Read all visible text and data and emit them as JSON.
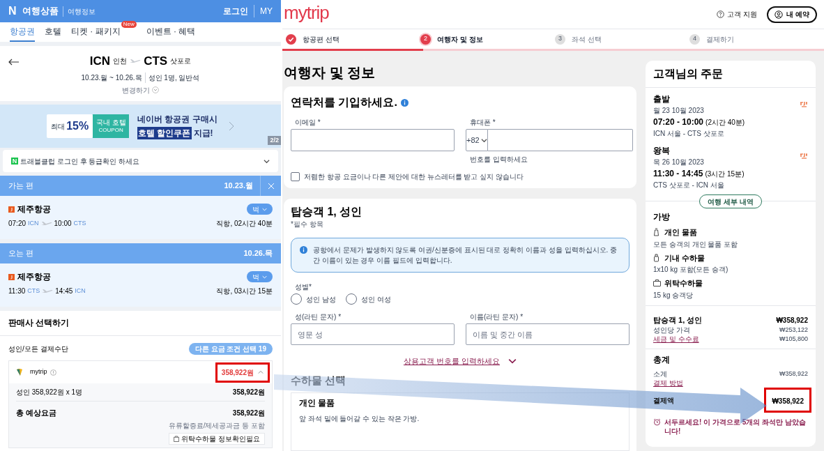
{
  "naver": {
    "header": {
      "logo": "N",
      "brand": "여행상품",
      "sub": "여행정보",
      "login": "로그인",
      "my": "MY"
    },
    "tabs": [
      {
        "label": "항공권",
        "selected": true
      },
      {
        "label": "호텔",
        "selected": false
      },
      {
        "label": "티켓 · 패키지",
        "selected": false,
        "badge": "New"
      },
      {
        "label": "이벤트 · 혜택",
        "selected": false
      }
    ],
    "route": {
      "from_code": "ICN",
      "from_city": "인천",
      "to_code": "CTS",
      "to_city": "삿포로",
      "dates": "10.23.월 ~ 10.26.목",
      "pax": "성인 1명, 일반석",
      "change": "변경하기"
    },
    "banner": {
      "coupon_prefix": "최대",
      "coupon_percent": "15%",
      "ticket_line": "국내 호텔",
      "ticket_sub": "COUPON",
      "headline": "네이버 항공권 구매시",
      "highlight": "호텔 할인쿠폰",
      "suffix": "지급!",
      "page": "2/2"
    },
    "notice": {
      "badge": "N",
      "text": "트래블클럽 로그인 후 등급확인 하세요"
    },
    "legs": [
      {
        "title": "가는 편",
        "date": "10.23.월",
        "closable": true,
        "airline": "제주항공",
        "fare": "벅",
        "dep_time": "07:20",
        "dep_code": "ICN",
        "arr_time": "10:00",
        "arr_code": "CTS",
        "info": "직항, 02시간 40분"
      },
      {
        "title": "오는 편",
        "date": "10.26.목",
        "closable": false,
        "airline": "제주항공",
        "fare": "벅",
        "dep_time": "11:30",
        "dep_code": "CTS",
        "arr_time": "14:45",
        "arr_code": "ICN",
        "info": "직항, 03시간 15분"
      }
    ],
    "seller": {
      "title": "판매사 선택하기",
      "subtitle": "성인/모든 결제수단",
      "other_button": "다른 요금 조건 선택 19",
      "vendor": "mytrip",
      "price": "358,922원",
      "highlighted": true,
      "lines": [
        {
          "label": "성인 358,922원 x 1명",
          "value": "358,922원",
          "kind": "plain"
        },
        {
          "label": "총 예상요금",
          "value": "358,922원",
          "kind": "total",
          "note": "유류할증료/제세공과금 등 포함"
        }
      ],
      "baggage_button": "위탁수하물 정보확인필요"
    }
  },
  "mytrip": {
    "logo": "mytrip",
    "support": "고객 지원",
    "my_booking": "내 예약",
    "steps": [
      {
        "label": "항공편 선택",
        "completed": true,
        "selected": false
      },
      {
        "number": "2",
        "label": "여행자 및 정보",
        "completed": false,
        "selected": true
      },
      {
        "number": "3",
        "label": "좌석 선택",
        "completed": false,
        "selected": false
      },
      {
        "number": "4",
        "label": "결제하기",
        "completed": false,
        "selected": false
      }
    ],
    "progress": {
      "level": 0.26
    },
    "page_title": "여행자 및 정보",
    "contact": {
      "title": "연락처를 기입하세요.",
      "email_label": "이메일 *",
      "phone_label": "휴대폰 *",
      "country_code": "+82",
      "phone_hint": "번호를 입력하세요",
      "newsletter": {
        "label": "저렴한 항공 요금이나 다른 제안에 대한 뉴스레터를 받고 싶지 않습니다",
        "checked": false
      }
    },
    "passenger": {
      "title": "탑승객 1, 성인",
      "required_note": "*필수 항목",
      "info": "공항에서 문제가 발생하지 않도록 여권/신분증에 표시된 대로 정확히 이름과 성을 입력하십시오. 중간 이름이 있는 경우 이름 필드에 입력합니다.",
      "gender_label": "성별*",
      "genders": [
        {
          "label": "성인 남성",
          "selected": false
        },
        {
          "label": "성인 여성",
          "selected": false
        }
      ],
      "last_name": {
        "label": "성(라틴 문자) *",
        "placeholder": "영문 성"
      },
      "first_name": {
        "label": "이름(라틴 문자) *",
        "placeholder": "이름 및 중간 이름"
      },
      "frequent_flyer": "상용고객 번호를 입력하세요"
    },
    "baggage": {
      "title": "수하물 선택",
      "item_title": "개인 물품",
      "item_desc": "앞 좌석 밑에 들어갈 수 있는 작은 가방."
    },
    "order": {
      "title": "고객님의 주문",
      "flights": [
        {
          "label": "출발",
          "date": "월 23 10월 2023",
          "times": "07:20 - 10:00",
          "duration": "(2시간 40분)",
          "route": "ICN 서울 - CTS 삿포로"
        },
        {
          "label": "왕복",
          "date": "목 26 10월 2023",
          "times": "11:30 - 14:45",
          "duration": "(3시간 15분)",
          "route": "CTS 삿포로 - ICN 서울"
        }
      ],
      "details_button": "여행 세부 내역",
      "bags_title": "가방",
      "bags": [
        {
          "kind": "personal",
          "title": "개인 물품",
          "desc": "모든 승객의 개인 물품 포함"
        },
        {
          "kind": "cabin",
          "title": "기내 수하물",
          "desc": "1x10 kg 포함(모든 승객)"
        },
        {
          "kind": "checked",
          "title": "위탁수하물",
          "desc": "15 kg 승객당"
        }
      ],
      "passenger": {
        "title": "탑승객 1, 성인",
        "total": "₩358,922",
        "rows": [
          {
            "label": "성인당 가격",
            "value": "₩253,122",
            "kind": "text"
          },
          {
            "label": "세금 및 수수료",
            "value": "₩105,800",
            "kind": "link"
          }
        ]
      },
      "totals": {
        "title": "총계",
        "subtotal_label": "소계",
        "subtotal": "₩358,922",
        "method_link": "결제 방법",
        "pay_label": "결제액",
        "pay_value": "₩358,922",
        "highlighted": true
      },
      "urgency": "서두르세요! 이 가격으로 5개의 좌석만 남았습니다!"
    }
  },
  "annotations": {
    "arrow": true
  }
}
